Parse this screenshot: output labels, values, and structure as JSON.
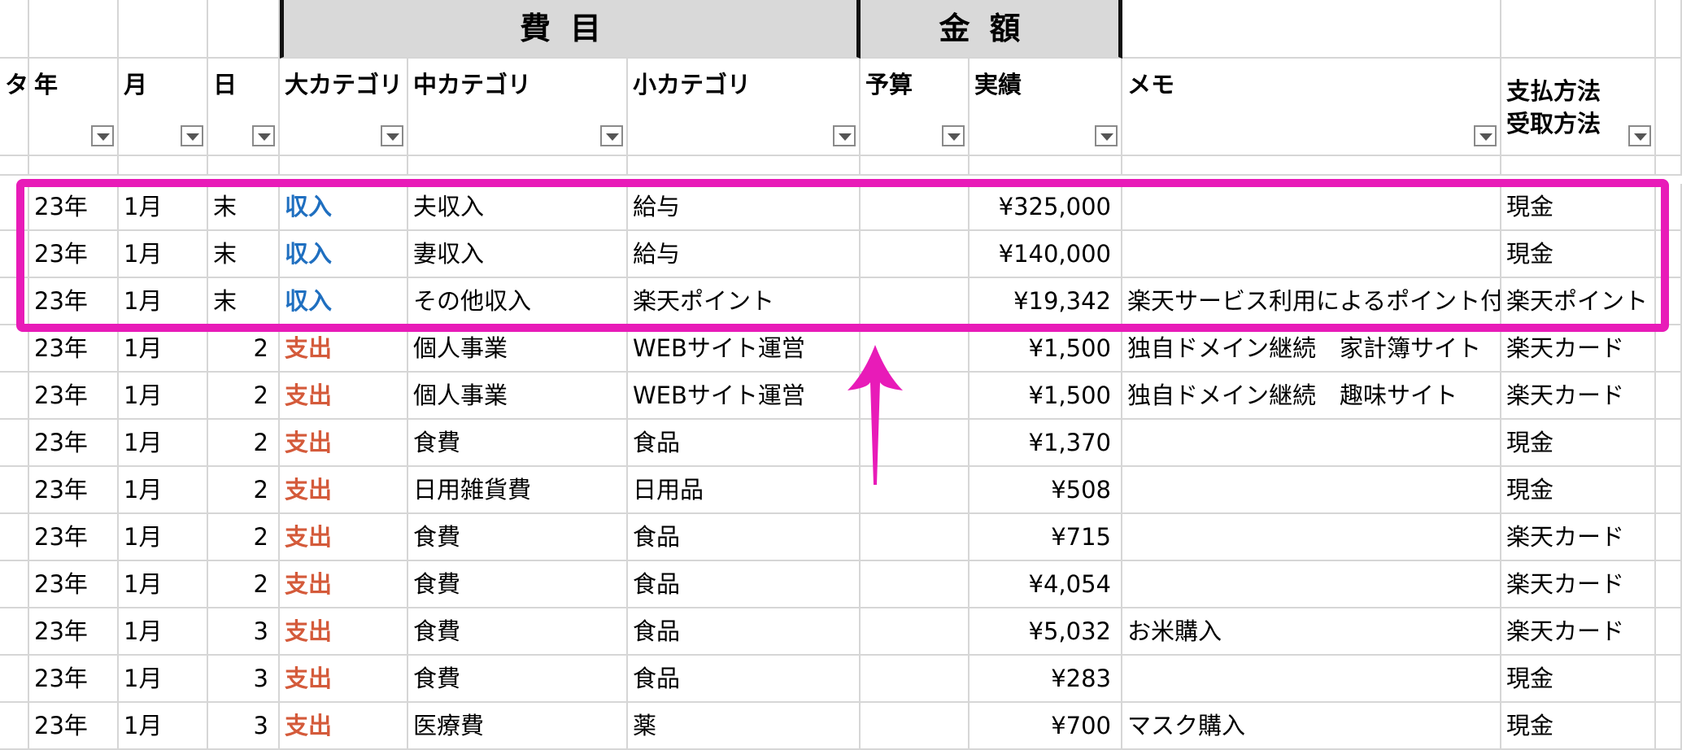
{
  "header_top": {
    "himoku": "費目",
    "kingaku": "金額"
  },
  "columns": {
    "left_stub": "タ",
    "year": "年",
    "month": "月",
    "day": "日",
    "major_cat": "大カテゴリ",
    "mid_cat": "中カテゴリ",
    "minor_cat": "小カテゴリ",
    "budget": "予算",
    "actual": "実績",
    "memo": "メモ",
    "pay_method_1": "支払方法",
    "pay_method_2": "受取方法"
  },
  "rows": [
    {
      "year": "23年",
      "month": "1月",
      "day": "末",
      "major": "収入",
      "type": "in",
      "mid": "夫収入",
      "minor": "給与",
      "budget": "",
      "actual": "¥325,000",
      "memo": "",
      "pay": "現金"
    },
    {
      "year": "23年",
      "month": "1月",
      "day": "末",
      "major": "収入",
      "type": "in",
      "mid": "妻収入",
      "minor": "給与",
      "budget": "",
      "actual": "¥140,000",
      "memo": "",
      "pay": "現金"
    },
    {
      "year": "23年",
      "month": "1月",
      "day": "末",
      "major": "収入",
      "type": "in",
      "mid": "その他収入",
      "minor": "楽天ポイント",
      "budget": "",
      "actual": "¥19,342",
      "memo": "楽天サービス利用によるポイント付与",
      "pay": "楽天ポイント"
    },
    {
      "year": "23年",
      "month": "1月",
      "day": "2",
      "major": "支出",
      "type": "out",
      "mid": "個人事業",
      "minor": "WEBサイト運営",
      "budget": "",
      "actual": "¥1,500",
      "memo": "独自ドメイン継続　家計簿サイト",
      "pay": "楽天カード"
    },
    {
      "year": "23年",
      "month": "1月",
      "day": "2",
      "major": "支出",
      "type": "out",
      "mid": "個人事業",
      "minor": "WEBサイト運営",
      "budget": "",
      "actual": "¥1,500",
      "memo": "独自ドメイン継続　趣味サイト",
      "pay": "楽天カード"
    },
    {
      "year": "23年",
      "month": "1月",
      "day": "2",
      "major": "支出",
      "type": "out",
      "mid": "食費",
      "minor": "食品",
      "budget": "",
      "actual": "¥1,370",
      "memo": "",
      "pay": "現金"
    },
    {
      "year": "23年",
      "month": "1月",
      "day": "2",
      "major": "支出",
      "type": "out",
      "mid": "日用雑貨費",
      "minor": "日用品",
      "budget": "",
      "actual": "¥508",
      "memo": "",
      "pay": "現金"
    },
    {
      "year": "23年",
      "month": "1月",
      "day": "2",
      "major": "支出",
      "type": "out",
      "mid": "食費",
      "minor": "食品",
      "budget": "",
      "actual": "¥715",
      "memo": "",
      "pay": "楽天カード"
    },
    {
      "year": "23年",
      "month": "1月",
      "day": "2",
      "major": "支出",
      "type": "out",
      "mid": "食費",
      "minor": "食品",
      "budget": "",
      "actual": "¥4,054",
      "memo": "",
      "pay": "楽天カード"
    },
    {
      "year": "23年",
      "month": "1月",
      "day": "3",
      "major": "支出",
      "type": "out",
      "mid": "食費",
      "minor": "食品",
      "budget": "",
      "actual": "¥5,032",
      "memo": "お米購入",
      "pay": "楽天カード"
    },
    {
      "year": "23年",
      "month": "1月",
      "day": "3",
      "major": "支出",
      "type": "out",
      "mid": "食費",
      "minor": "食品",
      "budget": "",
      "actual": "¥283",
      "memo": "",
      "pay": "現金"
    },
    {
      "year": "23年",
      "month": "1月",
      "day": "3",
      "major": "支出",
      "type": "out",
      "mid": "医療費",
      "minor": "薬",
      "budget": "",
      "actual": "¥700",
      "memo": "マスク購入",
      "pay": "現金"
    }
  ]
}
